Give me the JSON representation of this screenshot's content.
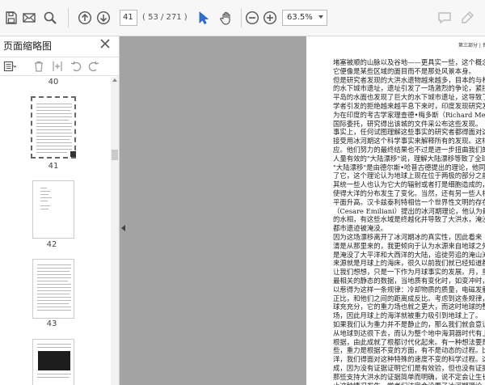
{
  "toolbar": {
    "current_page": "41",
    "page_count": "( 53 / 271 )",
    "zoom": "63.5%",
    "icons": [
      "save-icon",
      "mail-icon",
      "search-icon",
      "prev-page-icon",
      "next-page-icon",
      "select-tool-icon",
      "hand-tool-icon",
      "zoom-out-icon",
      "zoom-in-icon",
      "comment-icon",
      "highlight-pen-icon"
    ]
  },
  "panel": {
    "title": "页面缩略图",
    "tools": [
      "thumbnail-options-icon",
      "delete-page-icon",
      "insert-page-icon",
      "undo-icon",
      "redo-icon"
    ],
    "thumbnails": [
      {
        "label": "40"
      },
      {
        "label": "41"
      },
      {
        "label": "42"
      },
      {
        "label": "43"
      }
    ]
  },
  "page": {
    "header": "第三部分 | 世界大洪水",
    "lines": [
      "堵塞被顺的山脉以及谷地——更具实一些，这个概念就是一",
      "它便像是某些区域的面目而不是那处风景本身。",
      "    但是研究者发现的大洪水遗物越来越多，目本的与林国",
      "的水下城市遗址，遗址引发了一场激烈的争论，紧接着后占",
      "平岛的水面也发现了巨大的水下城市遗址，这导致了更大的",
      "学者引发的拒绝越来越平息下来时，印度发现研究发现了一座",
      "为在印度的考古学家理查德•梅多斯（Richard Meadows）领",
      "国际委托，研究得出该城的文件采公布这些发现。",
      "    事实上，任何试图理解这些事实的研究者都得面对这样",
      "接受用冰河期这个科学事实来解释所有的发现。这样，在",
      "应。他们努力的最终结果也不过是进一步扭曲我们的作事",
      "人量有效的\"大陆漂移\"说，理解大陆漂移等致了全球海",
      "\"大陆漂移\"是由德尔斯•哈普古德提出的理论，他同样一",
      "了它，这个理论认为地球上现在位于两极的部分之前是热带",
      "其统一些人也认为它大的辐射或者打是细胞造成的，并导致",
      "使得大洋的分布发生了变化。当然，还有另一些人相信两",
      "平面升高。汉卡兹泰利特相信一个世界性文明的存在，被",
      "（Cesare Emiliani）提出的冰河期理论，他认为最终能得",
      "的水相，有这些水域是终越化并导致了大洪水，淹没了城",
      "都市遗迹被淹没。",
      "    因为这场漂移离开了冰河期冰的真实性，因此看来",
      "清是从那里来的，我更倾向于认为水源来自地球之外，参加",
      "是淹没了大平洋和大西洋的大陆，追徙劳追的淹山淹地，如",
      "来源就是月球上的海床，很久以前我们就已经知道都是海冲",
      "    让我们想想，只是一下作为月球事实的发展。月，重",
      "最相关的静态的数据，当地质有变化时，如变冲时，重力",
      "以惹得为这样一条规律：冷却物质的质量，电磁发射（如先",
      "正比，和他们之间的距离成反比。考虑到这条规律，月球",
      "球充充分，它的重力场也就之更大，而这时地球的整个陆地",
      "场，因此月球上的海洋就被重力吸引到地球上了。",
      "    如果我们认为重力并不是静止的，那么我们就会意识到",
      "从地球到达很下去，而认为整个地中海洞器时代有上百万年",
      "根据，由此成就了根都讨代化起来。有一种想法要是，比",
      "些，重力是根据不变的方面，有不是动态的过程。比如利",
      "洋，我们得面对这种特殊的速度不变的科学过程。这些现",
      "成，因为没有证据证明它们是有效验，但也没有证据证明它",
      "    那些支持大洪水的证据简单而明确，说不定会让生长",
      "止这种情况发生，学者们注定会设置了冰河期理论，致人是"
    ]
  }
}
